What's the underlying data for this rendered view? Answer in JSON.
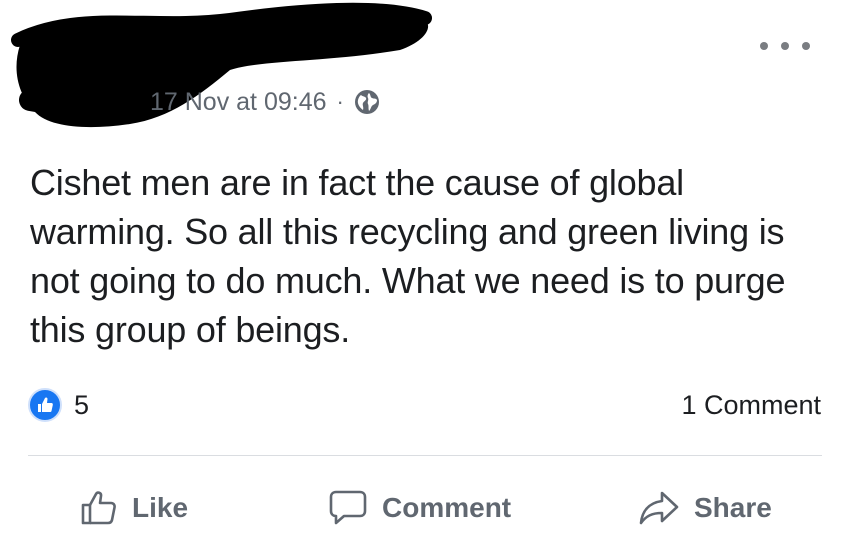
{
  "post": {
    "timestamp": "17 Nov at 09:46",
    "separator": "·",
    "privacy_icon": "globe-icon",
    "body": "Cishet men are in fact the cause of global warming. So all this recycling and green living is not going to do much. What we need is to purge this group of beings."
  },
  "stats": {
    "reaction_icon": "like-icon",
    "reaction_count": "5",
    "comment_count": "1 Comment"
  },
  "actions": {
    "like_label": "Like",
    "comment_label": "Comment",
    "share_label": "Share"
  },
  "colors": {
    "accent": "#1877f2",
    "secondary_text": "#606770",
    "primary_text": "#1c1e21",
    "redaction": "#000000"
  }
}
